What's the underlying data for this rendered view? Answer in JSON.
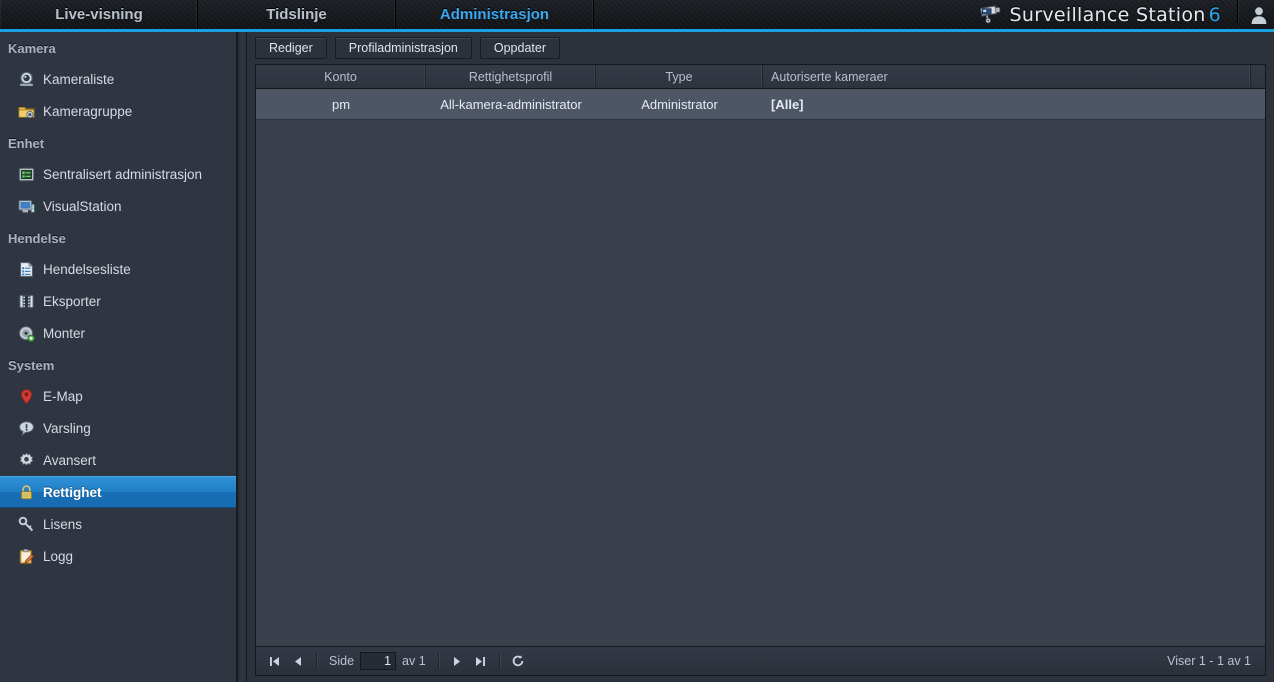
{
  "header": {
    "tabs": [
      {
        "label": "Live-visning",
        "active": false
      },
      {
        "label": "Tidslinje",
        "active": false
      },
      {
        "label": "Administrasjon",
        "active": true
      }
    ],
    "brand": "Surveillance Station",
    "brand_version": "6",
    "logo_icon": "cctv-camera-icon",
    "account_icon": "user-avatar-icon",
    "accent_color": "#1a9fe0"
  },
  "sidebar": {
    "groups": [
      {
        "title": "Kamera",
        "items": [
          {
            "label": "Kameraliste",
            "icon": "camera-icon",
            "selected": false
          },
          {
            "label": "Kameragruppe",
            "icon": "folder-camera-icon",
            "selected": false
          }
        ]
      },
      {
        "title": "Enhet",
        "items": [
          {
            "label": "Sentralisert administrasjon",
            "icon": "server-list-icon",
            "selected": false
          },
          {
            "label": "VisualStation",
            "icon": "monitor-icon",
            "selected": false
          }
        ]
      },
      {
        "title": "Hendelse",
        "items": [
          {
            "label": "Hendelsesliste",
            "icon": "document-list-icon",
            "selected": false
          },
          {
            "label": "Eksporter",
            "icon": "film-strip-icon",
            "selected": false
          },
          {
            "label": "Monter",
            "icon": "disc-mount-icon",
            "selected": false
          }
        ]
      },
      {
        "title": "System",
        "items": [
          {
            "label": "E-Map",
            "icon": "map-pin-icon",
            "selected": false
          },
          {
            "label": "Varsling",
            "icon": "notification-bubble-icon",
            "selected": false
          },
          {
            "label": "Avansert",
            "icon": "gear-icon",
            "selected": false
          },
          {
            "label": "Rettighet",
            "icon": "lock-icon",
            "selected": true
          },
          {
            "label": "Lisens",
            "icon": "key-icon",
            "selected": false
          },
          {
            "label": "Logg",
            "icon": "clipboard-pencil-icon",
            "selected": false
          }
        ]
      }
    ]
  },
  "toolbar": {
    "edit_label": "Rediger",
    "profile_admin_label": "Profiladministrasjon",
    "refresh_label": "Oppdater"
  },
  "table": {
    "columns": [
      "Konto",
      "Rettighetsprofil",
      "Type",
      "Autoriserte kameraer"
    ],
    "rows": [
      {
        "konto": "pm",
        "rettighetsprofil": "All-kamera-administrator",
        "type": "Administrator",
        "autoriserte_kameraer": "[Alle]"
      }
    ]
  },
  "pager": {
    "first_icon": "first-page-icon",
    "prev_icon": "previous-page-icon",
    "page_label": "Side",
    "page_value": "1",
    "of_label": "av 1",
    "next_icon": "next-page-icon",
    "last_icon": "last-page-icon",
    "reload_icon": "reload-icon",
    "status": "Viser 1 - 1 av 1"
  }
}
